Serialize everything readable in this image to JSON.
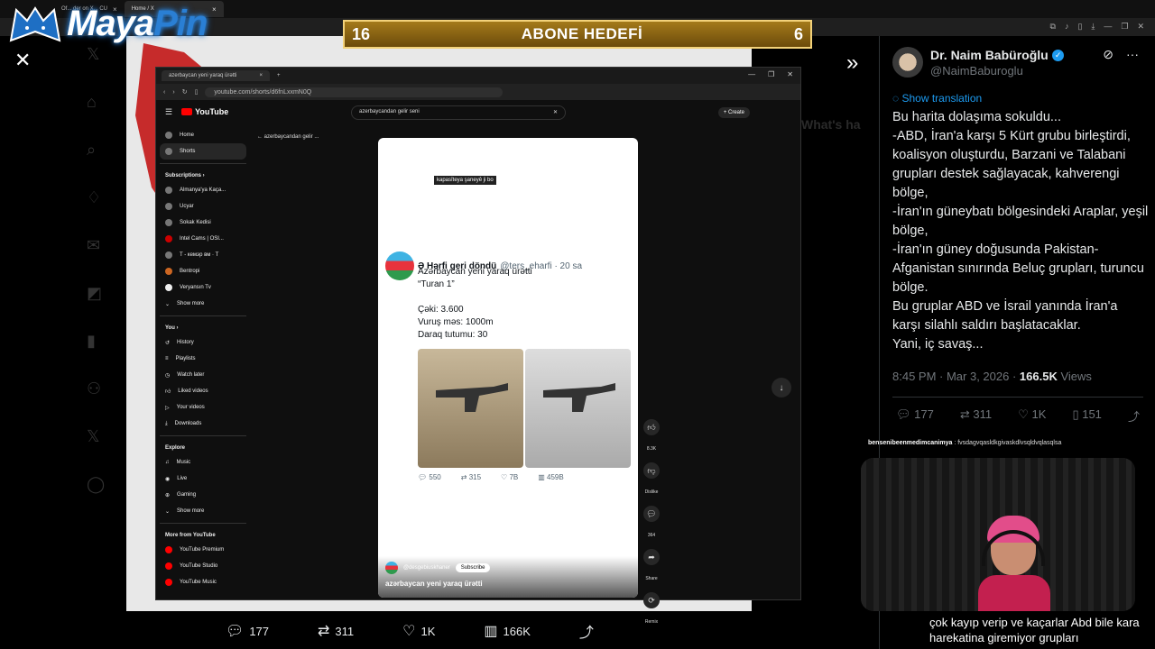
{
  "browser": {
    "tabs": [
      "Of... der on X... CU",
      "Home / X"
    ],
    "tab_close": "×"
  },
  "logo": {
    "part1": "Maya",
    "part2": "Pin"
  },
  "abone": {
    "left": "16",
    "label": "ABONE HEDEFİ",
    "right": "6"
  },
  "x_bg": {
    "close": "✕",
    "expand": "»",
    "right_text": "What's ha"
  },
  "inner": {
    "tab_title": "azerbaycan yeni yaraq ürətti",
    "url": "youtube.com/shorts/d6fnLxxmN0Q",
    "yt_brand": "YouTube",
    "search_text": "azerbaycandan gelir seni",
    "create": "+ Create",
    "back_label": "azerbaycandan gelir ...",
    "sidebar": {
      "main": [
        "Home",
        "Shorts"
      ],
      "subs_head": "Subscriptions  ›",
      "subs": [
        "Almanya'ya Kaça...",
        "Ucyar",
        "Sokak Kedisi",
        "Intel Cams | OSI...",
        "T - кемэр вм · T",
        "Bentropi",
        "Veryansın Tv",
        "Show more"
      ],
      "you_head": "You  ›",
      "you": [
        "History",
        "Playlists",
        "Watch later",
        "Liked videos",
        "Your videos",
        "Downloads"
      ],
      "explore_head": "Explore",
      "explore": [
        "Music",
        "Live",
        "Gaming",
        "Show more"
      ],
      "more_head": "More from YouTube",
      "more": [
        "YouTube Premium",
        "YouTube Studio",
        "YouTube Music"
      ]
    },
    "short": {
      "caption": "kapasîteya şaneyê ji bo",
      "tweet_name": "Ə Hərfi geri döndü",
      "tweet_handle": "@ters_eharfi · 20 sa",
      "tweet_lines": [
        "Azərbaycan yeni yaraq ürətti",
        "“Turan 1”",
        "",
        "Çəki: 3.600",
        "Vuruş məs: 1000m",
        "Daraq tutumu: 30"
      ],
      "actions": [
        "550",
        "315",
        "7B",
        "459B"
      ],
      "channel": "@desgebiuskhaner",
      "subscribe": "Subscribe",
      "title": "azərbaycan yeni yaraq ürətti"
    },
    "rail": [
      "8.3K",
      "Dislike",
      "364",
      "Share",
      "Remix"
    ]
  },
  "bottom_bar": {
    "replies": "177",
    "reposts": "311",
    "likes": "1K",
    "views": "166K"
  },
  "tweet": {
    "name": "Dr. Naim Babüroğlu",
    "handle": "@NaimBaburoglu",
    "show_translation": "Show translation",
    "lines": [
      "Bu harita dolaşıma sokuldu...",
      "-ABD, İran'a karşı 5 Kürt grubu birleştirdi, koalisyon oluşturdu, Barzani ve Talabani grupları destek sağlayacak, kahverengi bölge,",
      "-İran'ın güneybatı bölgesindeki Araplar, yeşil bölge,",
      "-İran'ın güney doğusunda Pakistan-Afganistan sınırında Beluç grupları, turuncu bölge.",
      "Bu gruplar ABD ve İsrail yanında İran'a karşı silahlı saldırı başlatacaklar.",
      "Yani, iç savaş..."
    ],
    "time": "8:45 PM · Mar 3, 2026 · ",
    "views_count": "166.5K",
    "views_label": " Views",
    "replies": "177",
    "reposts": "311",
    "likes": "1K",
    "bookmarks": "151"
  },
  "chat": {
    "user": "bensenibeenmedimcanimya",
    "msg": " : fvsdagvqasldkgivaskdlvsqldvqlasqlsa",
    "bottom": "çok kayıp verip ve kaçarlar Abd bile kara harekatina giremiyor grupları"
  }
}
